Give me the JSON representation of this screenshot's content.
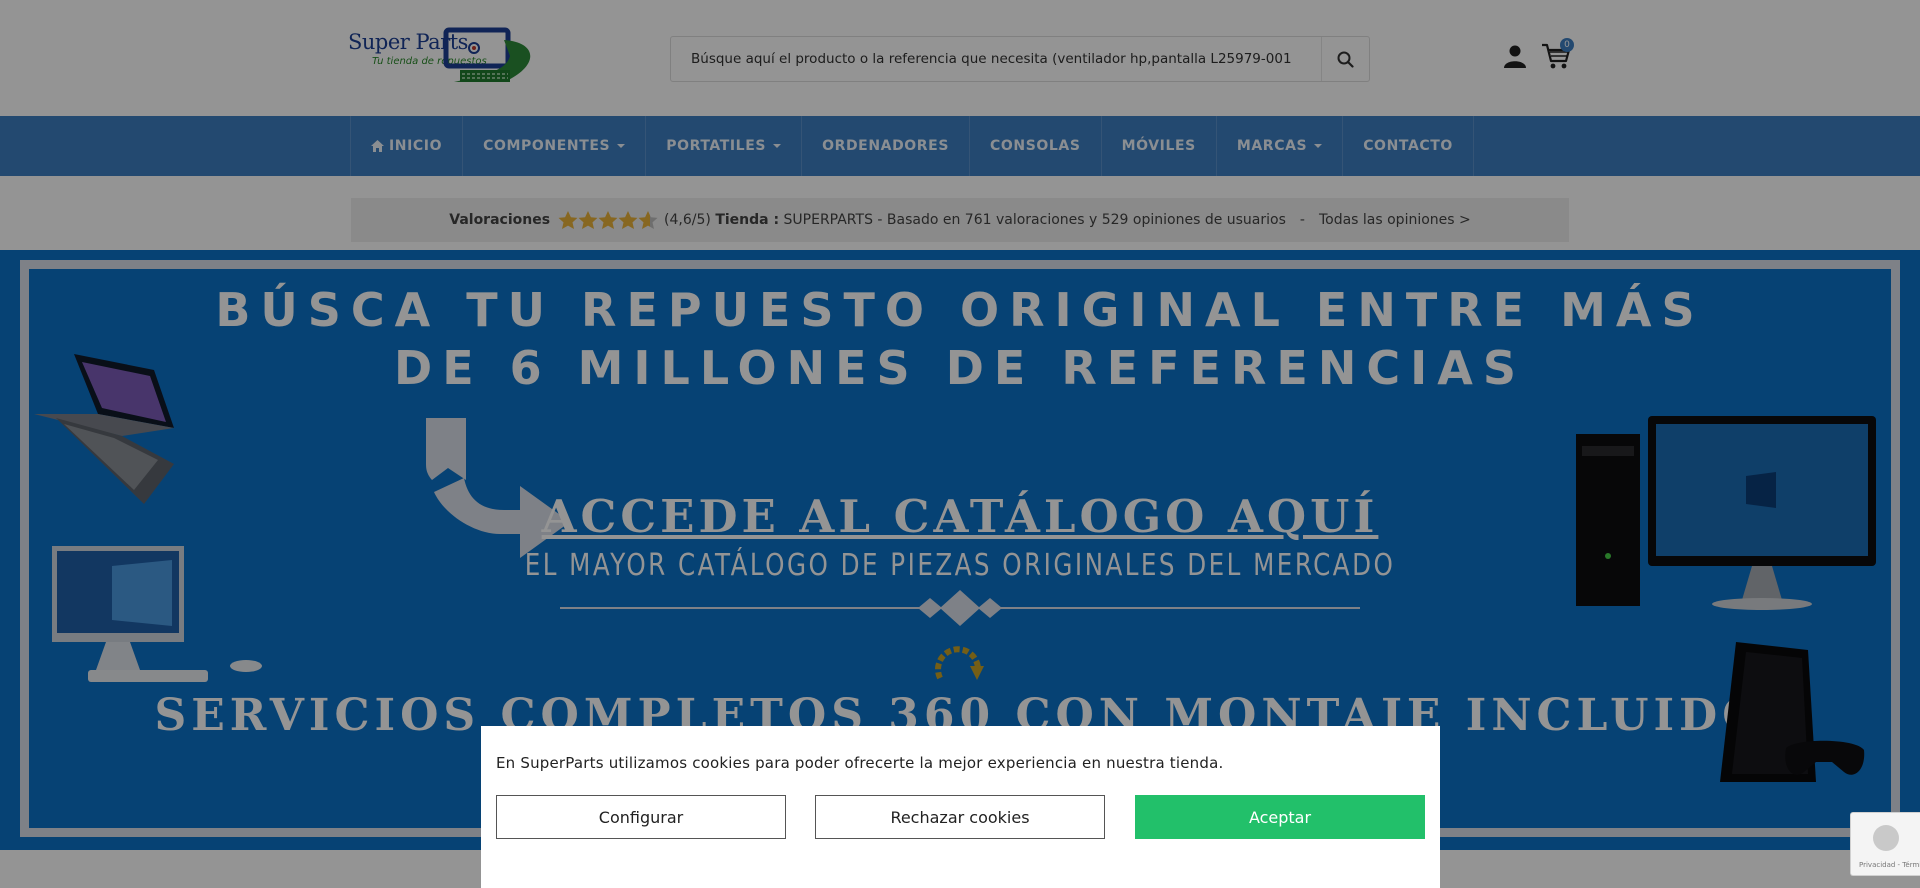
{
  "header": {
    "logo_brand": "Super Parts",
    "logo_tagline": "Tu tienda de repuestos",
    "search_placeholder": "Búsque aquí el producto o la referencia que necesita (ventilador hp,pantalla L25979-001",
    "cart_count": "0"
  },
  "nav": {
    "items": [
      {
        "label": "INICIO",
        "icon": "home-icon"
      },
      {
        "label": "COMPONENTES",
        "dropdown": true
      },
      {
        "label": "PORTATILES",
        "dropdown": true
      },
      {
        "label": "ORDENADORES"
      },
      {
        "label": "CONSOLAS"
      },
      {
        "label": "MÓVILES"
      },
      {
        "label": "MARCAS",
        "dropdown": true
      },
      {
        "label": "CONTACTO"
      }
    ]
  },
  "ratings": {
    "label": "Valoraciones",
    "stars_value": 4.6,
    "stars_max": 5,
    "score": "(4,6/5)",
    "store_label": "Tienda :",
    "summary": "SUPERPARTS - Basado en 761 valoraciones y 529 opiniones de usuarios",
    "separator": "-",
    "all_link": "Todas las opiniones >"
  },
  "banner": {
    "line1": "BÚSCA TU REPUESTO ORIGINAL ENTRE MÁS",
    "line2": "DE 6 MILLONES DE REFERENCIAS",
    "cta": "ACCEDE AL CATÁLOGO AQUÍ",
    "subtitle": "EL MAYOR CATÁLOGO DE PIEZAS ORIGINALES DEL MERCADO",
    "services": "SERVICIOS COMPLETOS 360 CON MONTAJE INCLUIDO"
  },
  "cookie": {
    "message": "En SuperParts utilizamos cookies para poder ofrecerte la mejor experiencia en nuestra tienda.",
    "configure_label": "Configurar",
    "reject_label": "Rechazar cookies",
    "accept_label": "Aceptar"
  },
  "recaptcha": {
    "text": "Privacidad - Términos"
  },
  "colors": {
    "nav_blue": "#3d7ec1",
    "banner_blue": "#0b72c9",
    "accept_green": "#22c06a",
    "star_gold": "#e8b23a"
  }
}
